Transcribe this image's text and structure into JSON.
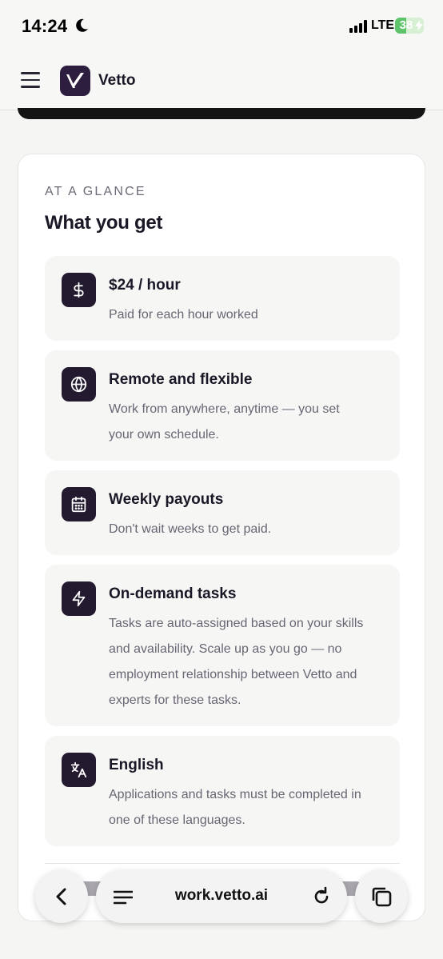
{
  "status_bar": {
    "time": "14:24",
    "network": "LTE",
    "battery": "38",
    "battery_fraction": 0.38
  },
  "header": {
    "brand": "Vetto",
    "menu_icon": "hamburger-menu-icon",
    "logo_icon": "vetto-logo-icon"
  },
  "section": {
    "eyebrow": "AT A GLANCE",
    "title": "What you get"
  },
  "features": [
    {
      "icon": "dollar-icon",
      "title": "$24 / hour",
      "lines": [
        "Paid for each hour worked"
      ]
    },
    {
      "icon": "globe-icon",
      "title": "Remote and flexible",
      "lines": [
        "Work from anywhere, anytime — you set",
        "your own schedule."
      ]
    },
    {
      "icon": "calendar-icon",
      "title": "Weekly payouts",
      "lines": [
        "Don't wait weeks to get paid."
      ]
    },
    {
      "icon": "lightning-icon",
      "title": "On-demand tasks",
      "lines": [
        "Tasks are auto-assigned based on your skills",
        "and availability. Scale up as you go — no",
        "employment relationship between Vetto and",
        "experts for these tasks."
      ]
    },
    {
      "icon": "translate-icon",
      "title": "English",
      "lines": [
        "Applications and tasks must be completed in",
        "one of these languages."
      ]
    }
  ],
  "browser": {
    "url": "work.vetto.ai"
  },
  "colors": {
    "brand_dark": "#2d1d3e",
    "icon_tile": "#231a30",
    "battery_green": "#5ec36a"
  }
}
